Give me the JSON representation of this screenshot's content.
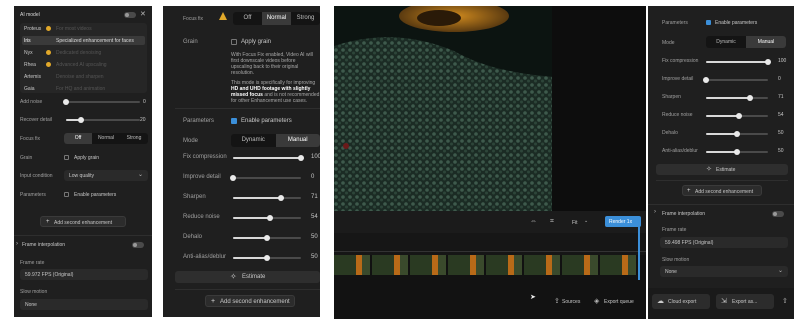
{
  "p1": {
    "header": "AI model",
    "models": [
      {
        "name": "Proteus",
        "desc": "For most videos"
      },
      {
        "name": "Iris",
        "desc": "Specialized enhancement for faces"
      },
      {
        "name": "Nyx",
        "desc": "Dedicated denoising"
      },
      {
        "name": "Rhea",
        "desc": "Advanced AI upscaling"
      },
      {
        "name": "Artemis",
        "desc": "Denoise and sharpen"
      },
      {
        "name": "Gaia",
        "desc": "For HQ and animation"
      }
    ],
    "add_noise": {
      "label": "Add noise",
      "value": "0",
      "level": 0
    },
    "recover_detail": {
      "label": "Recover detail",
      "value": "20",
      "level": 0.2
    },
    "focus_fix": {
      "label": "Focus fix",
      "options": [
        "Off",
        "Normal",
        "Strong"
      ],
      "selected": "Off"
    },
    "grain": {
      "label": "Grain",
      "check_label": "Apply grain"
    },
    "input_condition": {
      "label": "Input condition",
      "value": "Low quality"
    },
    "parameters": {
      "label": "Parameters",
      "check_label": "Enable parameters"
    },
    "add_second": "Add second enhancement",
    "frame_interpolation": "Frame interpolation",
    "frame_rate": {
      "label": "Frame rate",
      "value": "59.972 FPS (Original)"
    },
    "slow_motion": {
      "label": "Slow motion",
      "value": "None"
    }
  },
  "p2": {
    "focus_fix": {
      "label": "Focus fix",
      "options": [
        "Off",
        "Normal",
        "Strong"
      ],
      "selected": "Normal"
    },
    "grain": {
      "label": "Grain",
      "check_label": "Apply grain"
    },
    "note1": [
      "With Focus Fix enabled, Video AI will",
      "first downscale videos before",
      "upscaling back to their original",
      "resolution."
    ],
    "note2a": [
      "This mode is specifically for improving"
    ],
    "note2b": [
      "HD and UHD footage with slightly",
      "missed focus"
    ],
    "note2c": [
      "and is not recommended",
      "for other Enhancement use cases."
    ],
    "parameters": {
      "label": "Parameters",
      "check_label": "Enable parameters"
    },
    "mode": {
      "label": "Mode",
      "options": [
        "Dynamic",
        "Manual"
      ],
      "selected": "Manual"
    },
    "sliders": [
      {
        "label": "Fix compression",
        "value": "100",
        "level": 1.0
      },
      {
        "label": "Improve detail",
        "value": "0",
        "level": 0
      },
      {
        "label": "Sharpen",
        "value": "71",
        "level": 0.71
      },
      {
        "label": "Reduce noise",
        "value": "54",
        "level": 0.54
      },
      {
        "label": "Dehalo",
        "value": "50",
        "level": 0.5
      },
      {
        "label": "Anti-alias/deblur",
        "value": "50",
        "level": 0.5
      }
    ],
    "estimate": "Estimate",
    "add_second": "Add second enhancement"
  },
  "p3": {
    "toolbar": {
      "fit": "Fit",
      "render": "Render 1x"
    },
    "bottom": {
      "sources": "Sources",
      "export_queue": "Export queue"
    }
  },
  "p4": {
    "parameters": {
      "label": "Parameters",
      "check_label": "Enable parameters"
    },
    "mode": {
      "label": "Mode",
      "options": [
        "Dynamic",
        "Manual"
      ],
      "selected": "Manual"
    },
    "sliders": [
      {
        "label": "Fix compression",
        "value": "100",
        "level": 1.0
      },
      {
        "label": "Improve detail",
        "value": "0",
        "level": 0
      },
      {
        "label": "Sharpen",
        "value": "71",
        "level": 0.71
      },
      {
        "label": "Reduce noise",
        "value": "54",
        "level": 0.54
      },
      {
        "label": "Dehalo",
        "value": "50",
        "level": 0.5
      },
      {
        "label": "Anti-alias/deblur",
        "value": "50",
        "level": 0.5
      }
    ],
    "estimate": "Estimate",
    "add_second": "Add second enhancement",
    "frame_interpolation": "Frame interpolation",
    "frame_rate": {
      "label": "Frame rate",
      "value": "59.498 FPS (Original)"
    },
    "slow_motion": {
      "label": "Slow motion",
      "value": "None"
    },
    "cloud_export": "Cloud export",
    "export_as": "Export as..."
  },
  "colors": {
    "accent": "#3b8fd9",
    "warning": "#e2a92a",
    "panel": "#1f1f1f"
  }
}
